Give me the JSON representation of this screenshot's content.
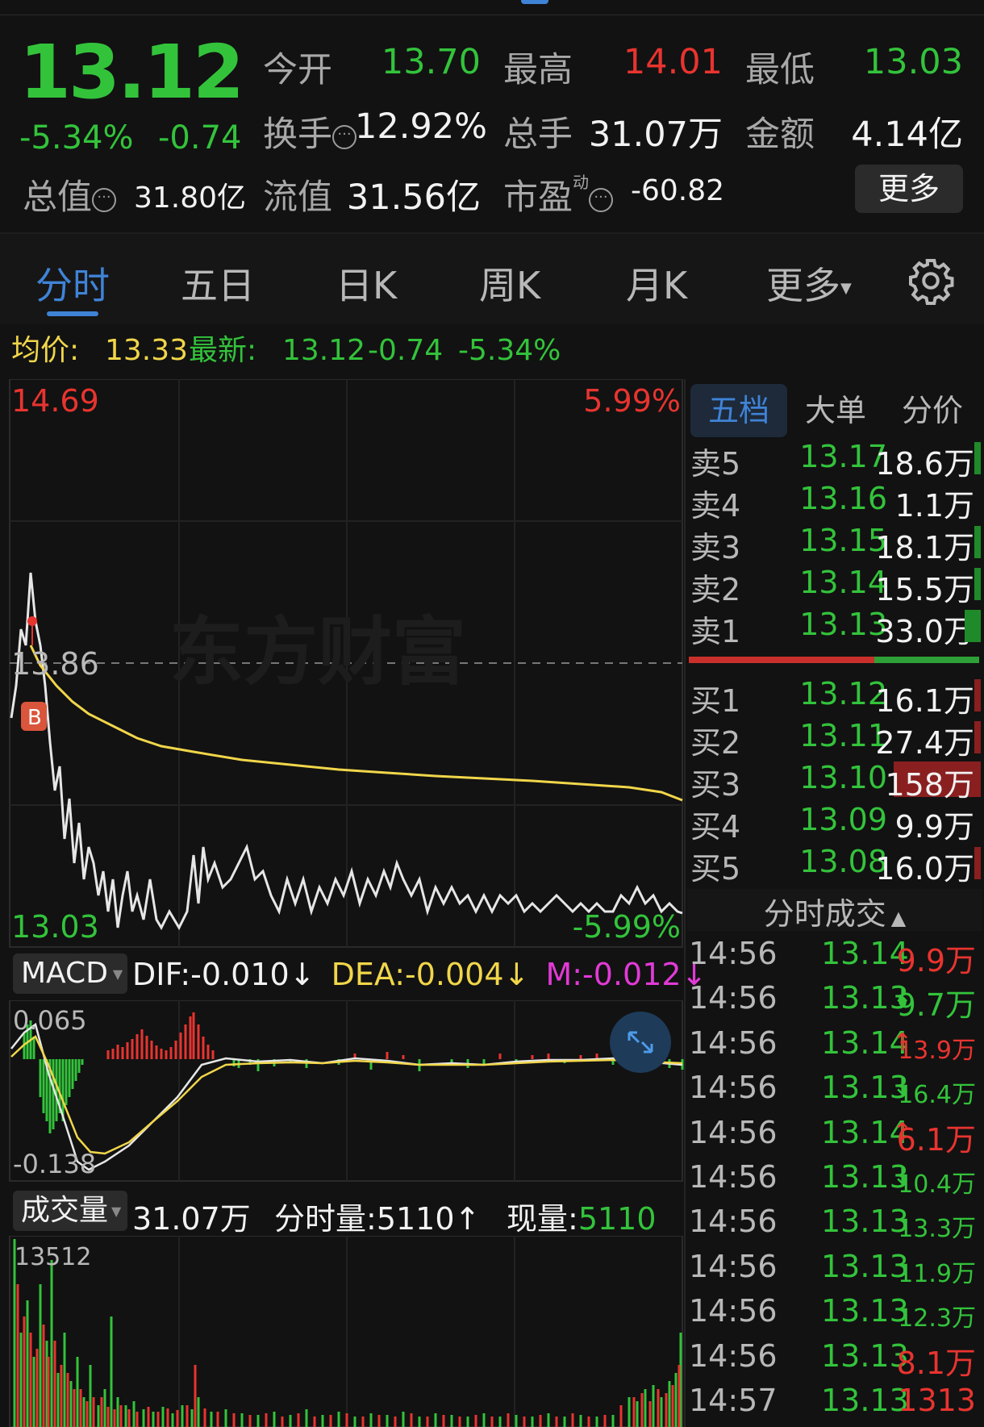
{
  "quote": {
    "price": "13.12",
    "change_pct": "-5.34%",
    "change": "-0.74",
    "open_label": "今开",
    "open": "13.70",
    "high_label": "最高",
    "high": "14.01",
    "low_label": "最低",
    "low": "13.03",
    "turnover_label": "换手",
    "turnover": "12.92%",
    "volume_label": "总手",
    "volume": "31.07万",
    "amount_label": "金额",
    "amount": "4.14亿",
    "mktcap_label": "总值",
    "mktcap": "31.80亿",
    "float_label": "流值",
    "float_cap": "31.56亿",
    "pe_label": "市盈",
    "pe_sup": "动",
    "pe": "-60.82",
    "more_button": "更多"
  },
  "tabs": [
    {
      "label": "分时",
      "active": true
    },
    {
      "label": "五日"
    },
    {
      "label": "日K"
    },
    {
      "label": "周K"
    },
    {
      "label": "月K"
    },
    {
      "label": "更多"
    }
  ],
  "info_bar": {
    "avg_label": "均价:",
    "avg_value": "13.33",
    "latest_label": "最新:",
    "latest_value": "13.12",
    "change": "-0.74",
    "change_pct": "-5.34%"
  },
  "intraday": {
    "y_max": "14.69",
    "y_min": "13.03",
    "pct_max": "5.99%",
    "pct_min": "-5.99%",
    "ref_price": "13.86",
    "watermark": "东方财富",
    "buy_marker": "B"
  },
  "macd": {
    "selector": "MACD",
    "dif": "DIF:-0.010",
    "dea": "DEA:-0.004",
    "m": "M:-0.012",
    "arrow": "↓",
    "y_max": "0.065",
    "y_min": "-0.138"
  },
  "volume_panel": {
    "selector": "成交量",
    "total": "31.07万",
    "minute_label": "分时量:",
    "minute_value": "5110",
    "minute_arrow": "↑",
    "current_label": "现量:",
    "current_value": "5110",
    "y_max": "13512"
  },
  "order_tabs": [
    {
      "label": "五档",
      "active": true
    },
    {
      "label": "大单"
    },
    {
      "label": "分价"
    }
  ],
  "asks": [
    {
      "label": "卖5",
      "price": "13.17",
      "vol": "18.6万"
    },
    {
      "label": "卖4",
      "price": "13.16",
      "vol": "1.1万"
    },
    {
      "label": "卖3",
      "price": "13.15",
      "vol": "18.1万"
    },
    {
      "label": "卖2",
      "price": "13.14",
      "vol": "15.5万"
    },
    {
      "label": "卖1",
      "price": "13.13",
      "vol": "33.0万"
    }
  ],
  "bids": [
    {
      "label": "买1",
      "price": "13.12",
      "vol": "16.1万"
    },
    {
      "label": "买2",
      "price": "13.11",
      "vol": "27.4万"
    },
    {
      "label": "买3",
      "price": "13.10",
      "vol": "158万"
    },
    {
      "label": "买4",
      "price": "13.09",
      "vol": "9.9万"
    },
    {
      "label": "买5",
      "price": "13.08",
      "vol": "16.0万"
    }
  ],
  "trades_header": "分时成交",
  "trades": [
    {
      "time": "14:56",
      "price": "13.14",
      "arrow": "",
      "vol": "9.9万",
      "color": "#e8342f",
      "small": false
    },
    {
      "time": "14:56",
      "price": "13.13",
      "arrow": "↓",
      "vol": "9.7万",
      "color": "#33c33b",
      "small": false
    },
    {
      "time": "14:56",
      "price": "13.14",
      "arrow": "↑",
      "vol": "13.9万",
      "color": "#e8342f",
      "small": true
    },
    {
      "time": "14:56",
      "price": "13.13",
      "arrow": "↓",
      "vol": "16.4万",
      "color": "#33c33b",
      "small": true
    },
    {
      "time": "14:56",
      "price": "13.14",
      "arrow": "↑",
      "vol": "6.1万",
      "color": "#e8342f",
      "small": false
    },
    {
      "time": "14:56",
      "price": "13.13",
      "arrow": "↓",
      "vol": "10.4万",
      "color": "#33c33b",
      "small": true
    },
    {
      "time": "14:56",
      "price": "13.13",
      "arrow": "",
      "vol": "13.3万",
      "color": "#33c33b",
      "small": true
    },
    {
      "time": "14:56",
      "price": "13.13",
      "arrow": "",
      "vol": "11.9万",
      "color": "#33c33b",
      "small": true
    },
    {
      "time": "14:56",
      "price": "13.13",
      "arrow": "",
      "vol": "12.3万",
      "color": "#33c33b",
      "small": true
    },
    {
      "time": "14:56",
      "price": "13.13",
      "arrow": "",
      "vol": "8.1万",
      "color": "#e8342f",
      "small": false
    },
    {
      "time": "14:57",
      "price": "13.13",
      "arrow": "",
      "vol": "1313",
      "color": "#e8342f",
      "small": false
    }
  ],
  "colors": {
    "up": "#e8342f",
    "down": "#33c33b",
    "avg_line": "#f1d64a",
    "price_line": "#e6e6e6",
    "accent": "#3f83d6",
    "background": "#121212"
  },
  "icons": [
    "settings-gear-icon",
    "expand-icon",
    "dropdown-triangle-icon"
  ]
}
